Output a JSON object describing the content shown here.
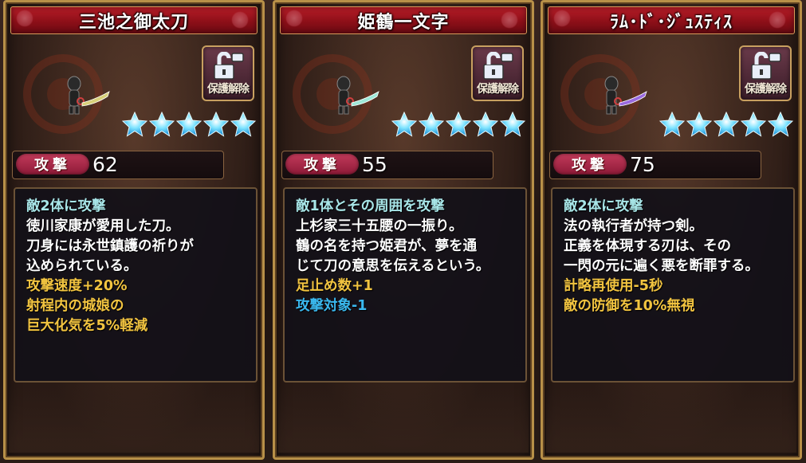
{
  "cards": [
    {
      "title": "三池之御太刀",
      "unlock_label": "保護解除",
      "stars": 5,
      "attack_label": "攻撃",
      "attack_value": "62",
      "blade_color": "#d8d07a",
      "lines": [
        {
          "text": "敵2体に攻撃",
          "color": "teal"
        },
        {
          "text": "徳川家康が愛用した刀。",
          "color": "white"
        },
        {
          "text": "刀身には永世鎮護の祈りが",
          "color": "white"
        },
        {
          "text": "込められている。",
          "color": "white"
        },
        {
          "text": "攻撃速度+20%",
          "color": "gold"
        },
        {
          "text": "射程内の城娘の",
          "color": "gold"
        },
        {
          "text": "巨大化気を5%軽減",
          "color": "gold"
        }
      ]
    },
    {
      "title": "姫鶴一文字",
      "unlock_label": "保護解除",
      "stars": 5,
      "attack_label": "攻撃",
      "attack_value": "55",
      "blade_color": "#9ee8d8",
      "lines": [
        {
          "text": "敵1体とその周囲を攻撃",
          "color": "teal"
        },
        {
          "text": "上杉家三十五腰の一振り。",
          "color": "white"
        },
        {
          "text": "鶴の名を持つ姫君が、夢を通",
          "color": "white"
        },
        {
          "text": "じて刀の意思を伝えるという。",
          "color": "white"
        },
        {
          "text": "足止め数+1",
          "color": "gold"
        },
        {
          "text": "攻撃対象-1",
          "color": "blue"
        }
      ]
    },
    {
      "title": "ﾗﾑ･ﾄﾞ･ｼﾞｭｽﾃｨｽ",
      "unlock_label": "保護解除",
      "stars": 5,
      "attack_label": "攻撃",
      "attack_value": "75",
      "blade_color": "#9a6ae0",
      "lines": [
        {
          "text": "敵2体に攻撃",
          "color": "teal"
        },
        {
          "text": "法の執行者が持つ剣。",
          "color": "white"
        },
        {
          "text": "正義を体現する刃は、その",
          "color": "white"
        },
        {
          "text": "一閃の元に遍く悪を断罪する。",
          "color": "white"
        },
        {
          "text": "計略再使用-5秒",
          "color": "gold"
        },
        {
          "text": "敵の防御を10%無視",
          "color": "gold"
        }
      ]
    }
  ],
  "icons": {
    "unlock": "unlock-icon",
    "star": "star-icon",
    "character": "chibi-character-icon",
    "crest": "clan-crest-emblem"
  }
}
